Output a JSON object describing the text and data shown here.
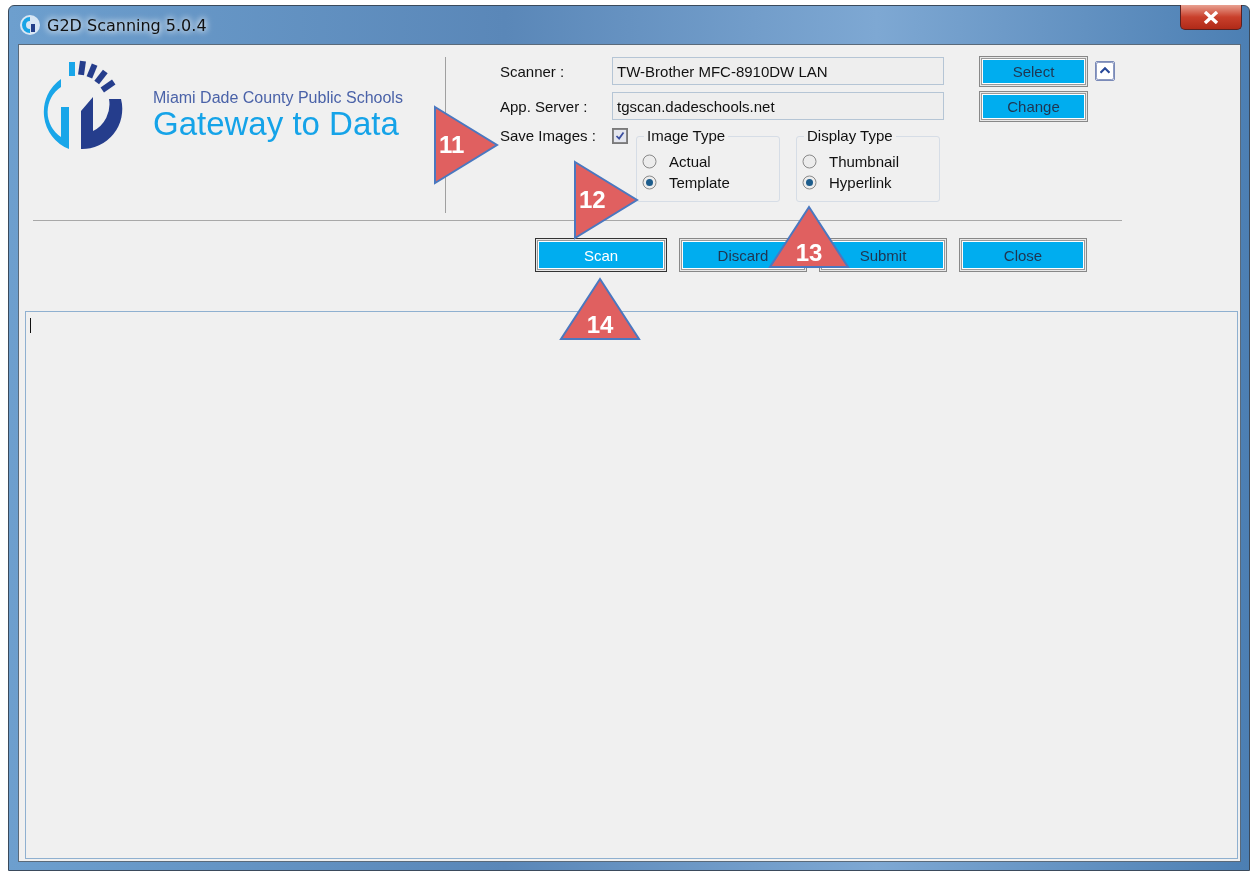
{
  "window": {
    "title": "G2D Scanning 5.0.4"
  },
  "logo": {
    "organization": "Miami Dade County Public Schools",
    "product": "Gateway to Data"
  },
  "fields": [
    {
      "label": "Scanner :",
      "value": "TW-Brother MFC-8910DW LAN"
    },
    {
      "label": "App. Server :",
      "value": "tgscan.dadeschools.net"
    }
  ],
  "side_buttons": [
    "Select",
    "Change"
  ],
  "save_images": {
    "label": "Save Images :",
    "checked": true
  },
  "groups": [
    {
      "title": "Image Type",
      "options": [
        {
          "label": "Actual",
          "selected": false
        },
        {
          "label": "Template",
          "selected": true
        }
      ]
    },
    {
      "title": "Display Type",
      "options": [
        {
          "label": "Thumbnail",
          "selected": false
        },
        {
          "label": "Hyperlink",
          "selected": true
        }
      ]
    }
  ],
  "actions": [
    {
      "label": "Scan",
      "focused": true
    },
    {
      "label": "Discard",
      "focused": false
    },
    {
      "label": "Submit",
      "focused": false
    },
    {
      "label": "Close",
      "focused": false
    }
  ],
  "callouts": [
    {
      "label": "11",
      "kind": "right"
    },
    {
      "label": "12",
      "kind": "right"
    },
    {
      "label": "13",
      "kind": "up"
    },
    {
      "label": "14",
      "kind": "up"
    }
  ]
}
